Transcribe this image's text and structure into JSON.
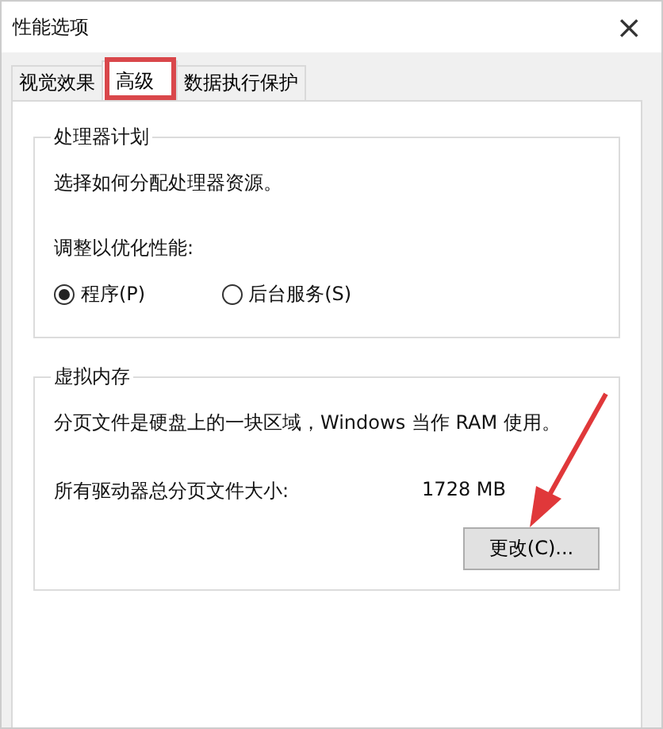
{
  "window": {
    "title": "性能选项",
    "close": "×"
  },
  "tabs": [
    {
      "label": "视觉效果",
      "selected": false
    },
    {
      "label": "高级",
      "selected": true
    },
    {
      "label": "数据执行保护",
      "selected": false
    }
  ],
  "processor_group": {
    "title": "处理器计划",
    "description": "选择如何分配处理器资源。",
    "prompt": "调整以优化性能:",
    "options": [
      {
        "label": "程序(P)",
        "selected": true
      },
      {
        "label": "后台服务(S)",
        "selected": false
      }
    ]
  },
  "memory_group": {
    "title": "虚拟内存",
    "description": "分页文件是硬盘上的一块区域，Windows 当作 RAM 使用。",
    "size_label": "所有驱动器总分页文件大小:",
    "size_value": "1728 MB",
    "button": "更改(C)..."
  }
}
